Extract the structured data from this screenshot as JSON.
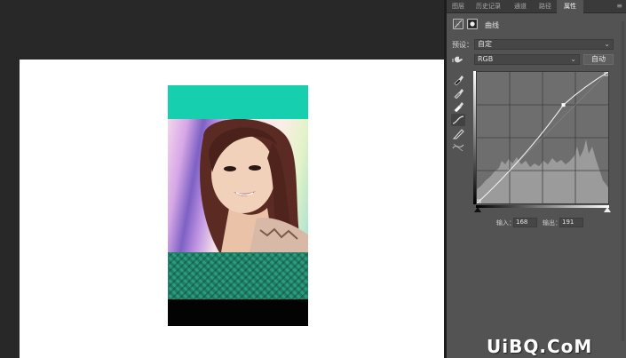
{
  "panel": {
    "tabs": [
      {
        "label": "图层",
        "active": false
      },
      {
        "label": "历史记录",
        "active": false
      },
      {
        "label": "通道",
        "active": false
      },
      {
        "label": "路径",
        "active": false
      },
      {
        "label": "属性",
        "active": true
      }
    ],
    "adjustment_label": "曲线",
    "preset": {
      "label": "预设：",
      "value": "自定"
    },
    "channel": {
      "value": "RGB"
    },
    "auto_label": "自动",
    "input": {
      "label": "输入：",
      "value": "168"
    },
    "output": {
      "label": "输出：",
      "value": "191"
    },
    "tools": [
      "eyedropper-black-icon",
      "eyedropper-gray-icon",
      "eyedropper-white-icon",
      "curve-point-icon",
      "pencil-icon",
      "smooth-icon"
    ]
  },
  "canvas": {
    "colors": {
      "band_top": "#16cfae",
      "band_mid": "#1f7d66",
      "band_bottom": "#030303",
      "document": "#ffffff"
    }
  },
  "curve": {
    "control_points": [
      [
        0,
        0
      ],
      [
        168,
        191
      ],
      [
        255,
        255
      ]
    ],
    "selected_point": [
      168,
      191
    ]
  },
  "watermark": "UiBQ.CoM"
}
